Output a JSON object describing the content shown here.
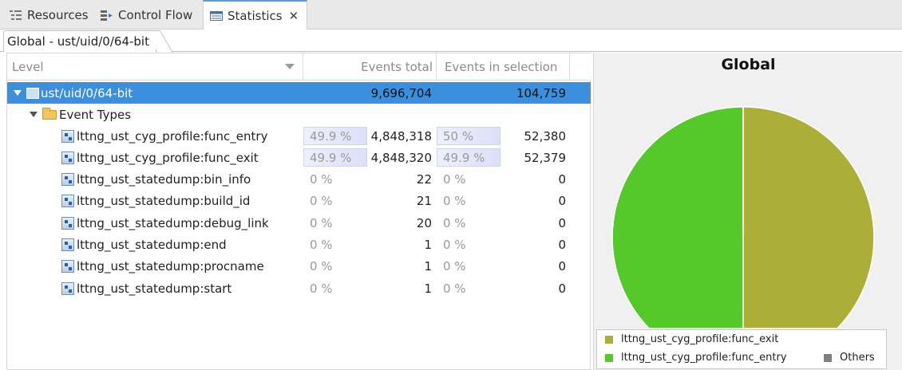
{
  "tabs": [
    {
      "label": "Resources",
      "icon": "resources-icon",
      "active": false
    },
    {
      "label": "Control Flow",
      "icon": "control-flow-icon",
      "active": false
    },
    {
      "label": "Statistics",
      "icon": "statistics-icon",
      "active": true
    }
  ],
  "subtab": {
    "label": "Global - ust/uid/0/64-bit"
  },
  "table": {
    "headers": {
      "level": "Level",
      "events_total": "Events total",
      "events_selection": "Events in selection"
    },
    "root": {
      "name": "ust/uid/0/64-bit",
      "total": "9,696,704",
      "selection": "104,759"
    },
    "group": {
      "name": "Event Types"
    },
    "rows": [
      {
        "name": "lttng_ust_cyg_profile:func_entry",
        "total_pct": "49.9 %",
        "total_frac": 0.499,
        "total": "4,848,318",
        "sel_pct": "50 %",
        "sel_frac": 0.5,
        "selection": "52,380"
      },
      {
        "name": "lttng_ust_cyg_profile:func_exit",
        "total_pct": "49.9 %",
        "total_frac": 0.499,
        "total": "4,848,320",
        "sel_pct": "49.9 %",
        "sel_frac": 0.499,
        "selection": "52,379"
      },
      {
        "name": "lttng_ust_statedump:bin_info",
        "total_pct": "0 %",
        "total_frac": 0,
        "total": "22",
        "sel_pct": "0 %",
        "sel_frac": 0,
        "selection": "0"
      },
      {
        "name": "lttng_ust_statedump:build_id",
        "total_pct": "0 %",
        "total_frac": 0,
        "total": "21",
        "sel_pct": "0 %",
        "sel_frac": 0,
        "selection": "0"
      },
      {
        "name": "lttng_ust_statedump:debug_link",
        "total_pct": "0 %",
        "total_frac": 0,
        "total": "20",
        "sel_pct": "0 %",
        "sel_frac": 0,
        "selection": "0"
      },
      {
        "name": "lttng_ust_statedump:end",
        "total_pct": "0 %",
        "total_frac": 0,
        "total": "1",
        "sel_pct": "0 %",
        "sel_frac": 0,
        "selection": "0"
      },
      {
        "name": "lttng_ust_statedump:procname",
        "total_pct": "0 %",
        "total_frac": 0,
        "total": "1",
        "sel_pct": "0 %",
        "sel_frac": 0,
        "selection": "0"
      },
      {
        "name": "lttng_ust_statedump:start",
        "total_pct": "0 %",
        "total_frac": 0,
        "total": "1",
        "sel_pct": "0 %",
        "sel_frac": 0,
        "selection": "0"
      }
    ]
  },
  "chart_data": {
    "type": "pie",
    "title": "Global",
    "slices": [
      {
        "label": "lttng_ust_cyg_profile:func_exit",
        "value": 4848320,
        "color": "#abaf38"
      },
      {
        "label": "lttng_ust_cyg_profile:func_entry",
        "value": 4848318,
        "color": "#55c82a"
      },
      {
        "label": "Others",
        "value": 66,
        "color": "#7f7f7f"
      }
    ],
    "legend_placement": "bottom"
  },
  "colors": {
    "selection": "#3b8fdd",
    "bar_fill": "#dcdff8"
  }
}
